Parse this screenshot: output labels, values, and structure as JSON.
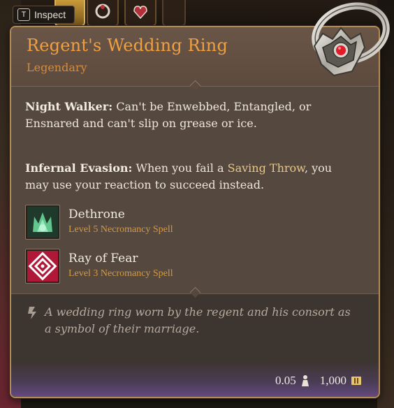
{
  "hud": {
    "inspect_key": "T",
    "inspect_label": "Inspect"
  },
  "item": {
    "name": "Regent's Wedding Ring",
    "rarity": "Legendary",
    "properties": [
      {
        "name": "Night Walker:",
        "text": "Can't be Enwebbed, Entangled, or Ensnared and can't slip on grease or ice."
      },
      {
        "name": "Infernal Evasion:",
        "text_before": "When you fail a",
        "highlight": "Saving Throw",
        "text_after": ", you may use your reaction to succeed instead."
      }
    ],
    "spells": [
      {
        "name": "Dethrone",
        "detail": "Level 5 Necromancy Spell",
        "icon": "green-crown-icon"
      },
      {
        "name": "Ray of Fear",
        "detail": "Level 3 Necromancy Spell",
        "icon": "red-spiral-icon"
      }
    ],
    "lore": "A wedding ring worn by the regent and his consort as a symbol of their marriage.",
    "weight": "0.05",
    "value": "1,000",
    "icons": {
      "weight": "weight-icon",
      "value": "gold-coin-icon",
      "lore": "quill-icon"
    }
  },
  "colors": {
    "title": "#f0a040",
    "rarity": "#d98a38",
    "spell_detail": "#d49a48",
    "highlight": "#e9c98a",
    "border": "#b28a55"
  }
}
